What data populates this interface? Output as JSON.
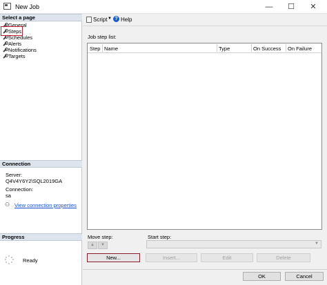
{
  "window": {
    "title": "New Job",
    "minimize": "—",
    "maximize": "☐",
    "close": "✕"
  },
  "left": {
    "select_page_header": "Select a page",
    "pages": [
      {
        "label": "General"
      },
      {
        "label": "Steps"
      },
      {
        "label": "Schedules"
      },
      {
        "label": "Alerts"
      },
      {
        "label": "Notifications"
      },
      {
        "label": "Targets"
      }
    ],
    "selected_page": "Steps",
    "connection_header": "Connection",
    "server_label": "Server:",
    "server_value": "Q4V4Y6Y2\\SQL2019GA",
    "connection_label": "Connection:",
    "connection_value": "sa",
    "view_link": "View connection properties",
    "progress_header": "Progress",
    "progress_status": "Ready"
  },
  "toolbar": {
    "script_label": "Script",
    "help_label": "Help"
  },
  "main": {
    "job_step_list_label": "Job step list:",
    "columns": [
      "Step",
      "Name",
      "Type",
      "On Success",
      "On Failure"
    ],
    "move_step_label": "Move step:",
    "start_step_label": "Start step:",
    "buttons": {
      "new": "New...",
      "insert": "Insert...",
      "edit": "Edit",
      "delete": "Delete"
    }
  },
  "footer": {
    "ok": "OK",
    "cancel": "Cancel"
  }
}
